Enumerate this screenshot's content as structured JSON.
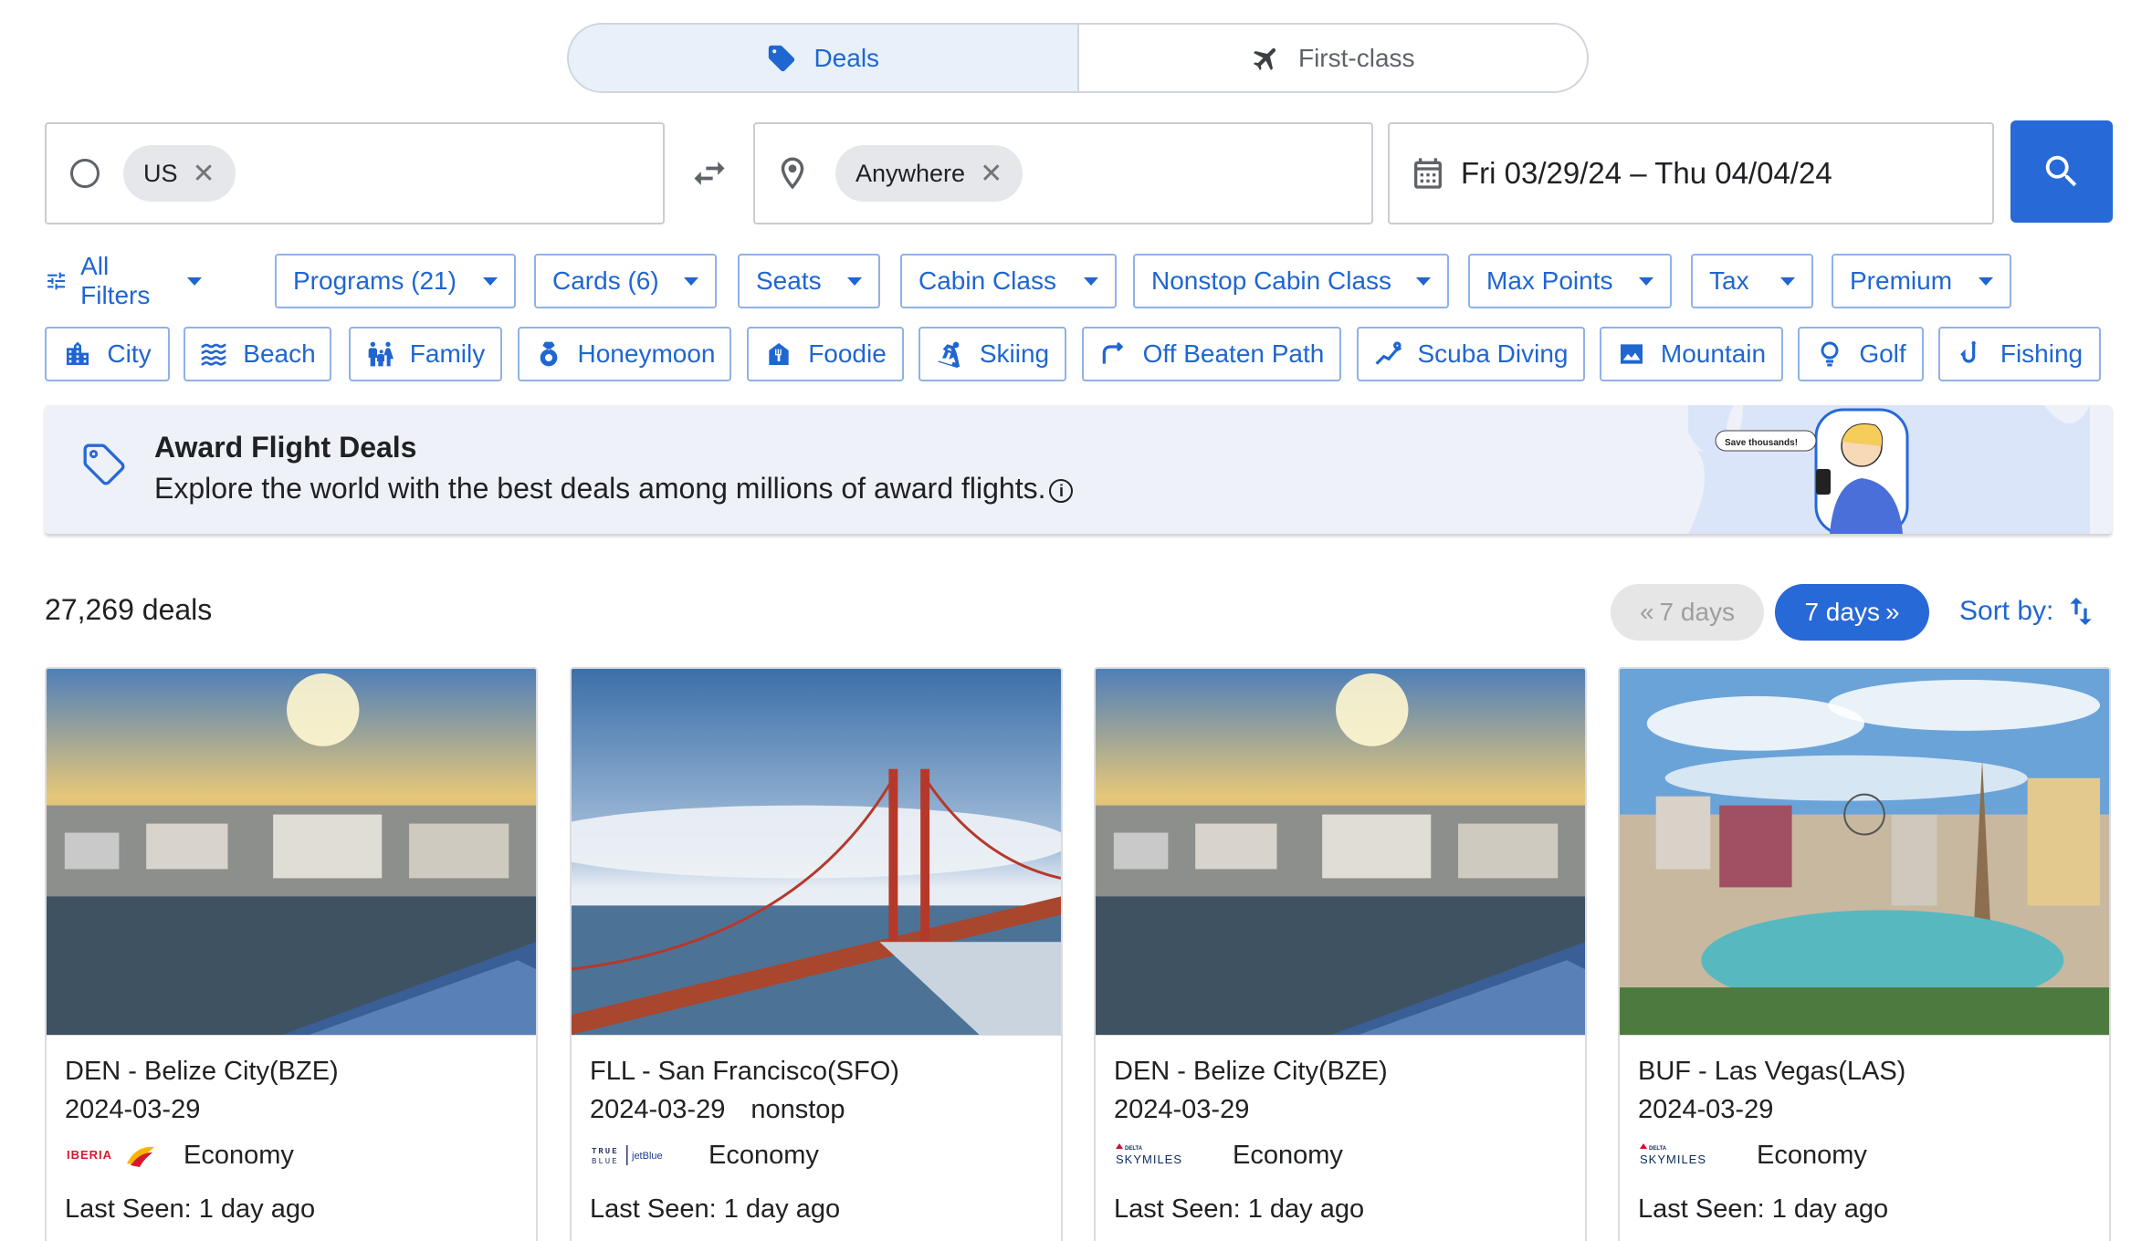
{
  "tabs": [
    {
      "label": "Deals",
      "icon": "tag-icon",
      "active": true
    },
    {
      "label": "First-class",
      "icon": "airplane-icon",
      "active": false
    }
  ],
  "search": {
    "origin_chip": "US",
    "destination_chip": "Anywhere",
    "date_range": "Fri 03/29/24 – Thu 04/04/24"
  },
  "filters": {
    "all_filters": "All Filters",
    "dropdowns": [
      "Programs (21)",
      "Cards (6)",
      "Seats",
      "Cabin Class",
      "Nonstop Cabin Class",
      "Max Points",
      "Tax",
      "Premium"
    ]
  },
  "categories": [
    "City",
    "Beach",
    "Family",
    "Honeymoon",
    "Foodie",
    "Skiing",
    "Off Beaten Path",
    "Scuba Diving",
    "Mountain",
    "Golf",
    "Fishing"
  ],
  "banner": {
    "title": "Award Flight Deals",
    "subtitle": "Explore the world with the best deals among millions of award flights.",
    "bubble": "Save thousands!"
  },
  "results": {
    "count": "27,269 deals",
    "prev_label": "7 days",
    "next_label": "7 days",
    "sort_label": "Sort by:"
  },
  "cards": [
    {
      "route": "DEN - Belize City(BZE)",
      "date": "2024-03-29",
      "nonstop": "",
      "program": "IBERIA",
      "cabin": "Economy",
      "last_seen": "Last Seen: 1 day ago"
    },
    {
      "route": "FLL - San Francisco(SFO)",
      "date": "2024-03-29",
      "nonstop": "nonstop",
      "program": "TRUE BLUE | jetBlue",
      "cabin": "Economy",
      "last_seen": "Last Seen: 1 day ago"
    },
    {
      "route": "DEN - Belize City(BZE)",
      "date": "2024-03-29",
      "nonstop": "",
      "program": "DELTA SKYMILES",
      "cabin": "Economy",
      "last_seen": "Last Seen: 1 day ago"
    },
    {
      "route": "BUF - Las Vegas(LAS)",
      "date": "2024-03-29",
      "nonstop": "",
      "program": "DELTA SKYMILES",
      "cabin": "Economy",
      "last_seen": "Last Seen: 1 day ago"
    }
  ],
  "colors": {
    "accent": "#2769d6",
    "link": "#1f66d1",
    "banner_bg": "#eef1f7"
  }
}
